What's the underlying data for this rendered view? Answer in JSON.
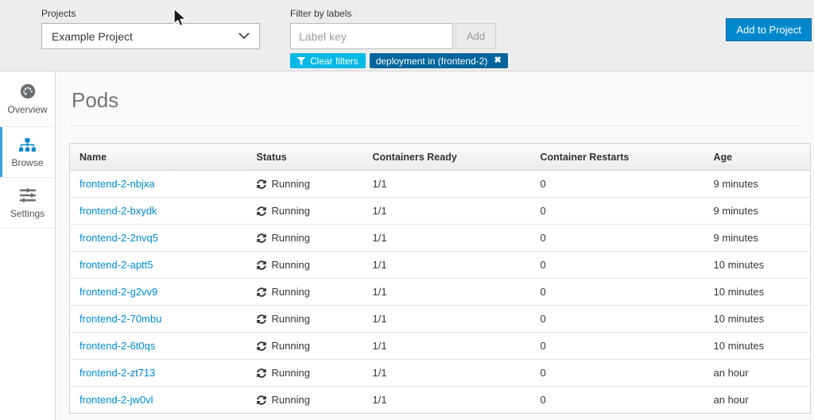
{
  "toolbar": {
    "projects_label": "Projects",
    "project_selected": "Example Project",
    "filter_label": "Filter by labels",
    "filter_placeholder": "Label key",
    "add_button": "Add",
    "clear_filters_label": "Clear filters",
    "active_filter_chip": "deployment in (frontend-2)",
    "chip_remove_glyph": "✖",
    "add_to_project_label": "Add to Project"
  },
  "sidebar": {
    "items": [
      {
        "label": "Overview",
        "icon": "dashboard-icon",
        "active": false
      },
      {
        "label": "Browse",
        "icon": "sitemap-icon",
        "active": true
      },
      {
        "label": "Settings",
        "icon": "sliders-icon",
        "active": false
      }
    ]
  },
  "main": {
    "title": "Pods",
    "table": {
      "columns": [
        "Name",
        "Status",
        "Containers Ready",
        "Container Restarts",
        "Age"
      ],
      "rows": [
        {
          "name": "frontend-2-nbjxa",
          "status": "Running",
          "status_icon": "refresh-icon",
          "containers_ready": "1/1",
          "container_restarts": "0",
          "age": "9 minutes"
        },
        {
          "name": "frontend-2-bxydk",
          "status": "Running",
          "status_icon": "refresh-icon",
          "containers_ready": "1/1",
          "container_restarts": "0",
          "age": "9 minutes"
        },
        {
          "name": "frontend-2-2nvq5",
          "status": "Running",
          "status_icon": "refresh-icon",
          "containers_ready": "1/1",
          "container_restarts": "0",
          "age": "9 minutes"
        },
        {
          "name": "frontend-2-aptt5",
          "status": "Running",
          "status_icon": "refresh-icon",
          "containers_ready": "1/1",
          "container_restarts": "0",
          "age": "10 minutes"
        },
        {
          "name": "frontend-2-g2vv9",
          "status": "Running",
          "status_icon": "refresh-icon",
          "containers_ready": "1/1",
          "container_restarts": "0",
          "age": "10 minutes"
        },
        {
          "name": "frontend-2-70mbu",
          "status": "Running",
          "status_icon": "refresh-icon",
          "containers_ready": "1/1",
          "container_restarts": "0",
          "age": "10 minutes"
        },
        {
          "name": "frontend-2-6t0qs",
          "status": "Running",
          "status_icon": "refresh-icon",
          "containers_ready": "1/1",
          "container_restarts": "0",
          "age": "10 minutes"
        },
        {
          "name": "frontend-2-zt713",
          "status": "Running",
          "status_icon": "refresh-icon",
          "containers_ready": "1/1",
          "container_restarts": "0",
          "age": "an hour"
        },
        {
          "name": "frontend-2-jw0vl",
          "status": "Running",
          "status_icon": "refresh-icon",
          "containers_ready": "1/1",
          "container_restarts": "0",
          "age": "an hour"
        }
      ]
    }
  },
  "colors": {
    "accent": "#0088ce",
    "accent-border": "#00659c",
    "chip-bg": "#00659c",
    "clear-filters-bg": "#00b9e4",
    "active-stripe": "#39a5dc",
    "link": "#0088ce",
    "topbar-bg": "#ededed",
    "content-bg": "#fafafa",
    "border": "#d1d1d1",
    "text": "#363636",
    "muted": "#72767b"
  }
}
